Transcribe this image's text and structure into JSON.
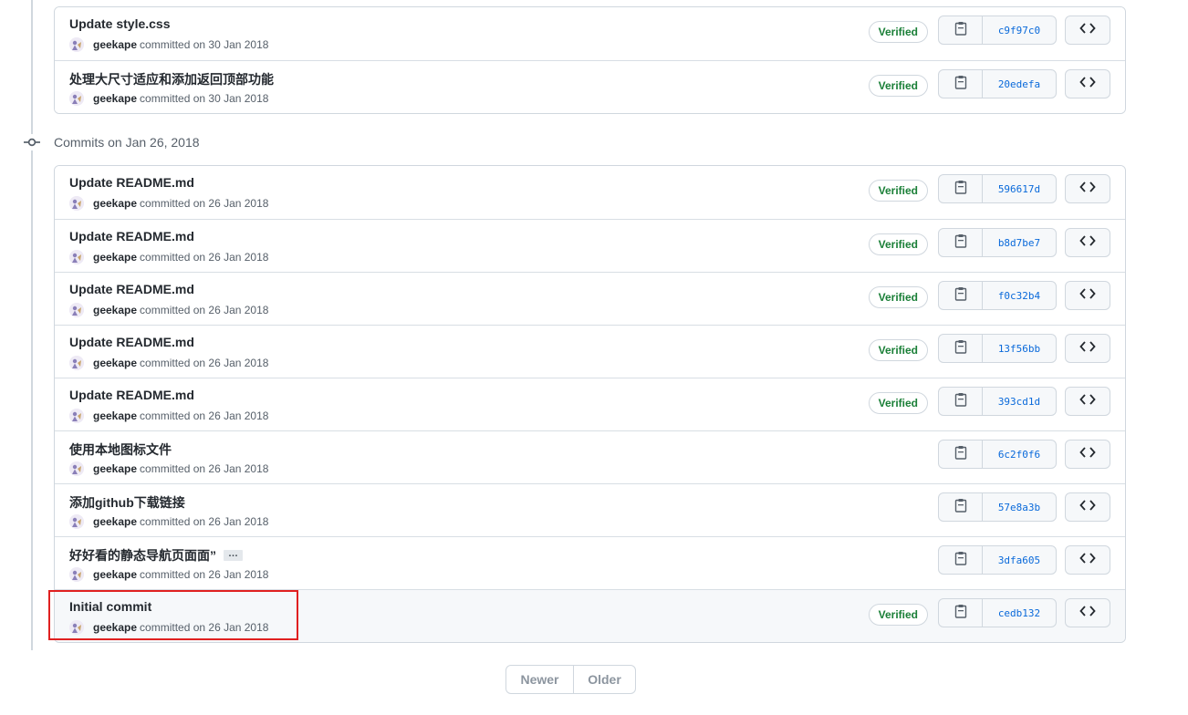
{
  "groups": [
    {
      "header": "",
      "commits": [
        {
          "title": "Update style.css",
          "author": "geekape",
          "date_text": "committed on 30 Jan 2018",
          "verified": "Verified",
          "sha": "c9f97c0"
        },
        {
          "title": "处理大尺寸适应和添加返回顶部功能",
          "author": "geekape",
          "date_text": "committed on 30 Jan 2018",
          "verified": "Verified",
          "sha": "20edefa"
        }
      ]
    },
    {
      "header": "Commits on Jan 26, 2018",
      "commits": [
        {
          "title": "Update README.md",
          "author": "geekape",
          "date_text": "committed on 26 Jan 2018",
          "verified": "Verified",
          "sha": "596617d"
        },
        {
          "title": "Update README.md",
          "author": "geekape",
          "date_text": "committed on 26 Jan 2018",
          "verified": "Verified",
          "sha": "b8d7be7"
        },
        {
          "title": "Update README.md",
          "author": "geekape",
          "date_text": "committed on 26 Jan 2018",
          "verified": "Verified",
          "sha": "f0c32b4"
        },
        {
          "title": "Update README.md",
          "author": "geekape",
          "date_text": "committed on 26 Jan 2018",
          "verified": "Verified",
          "sha": "13f56bb"
        },
        {
          "title": "Update README.md",
          "author": "geekape",
          "date_text": "committed on 26 Jan 2018",
          "verified": "Verified",
          "sha": "393cd1d"
        },
        {
          "title": "使用本地图标文件",
          "author": "geekape",
          "date_text": "committed on 26 Jan 2018",
          "verified": "",
          "sha": "6c2f0f6"
        },
        {
          "title": "添加github下载链接",
          "author": "geekape",
          "date_text": "committed on 26 Jan 2018",
          "verified": "",
          "sha": "57e8a3b"
        },
        {
          "title": "好好看的静态导航页面面”",
          "author": "geekape",
          "date_text": "committed on 26 Jan 2018",
          "verified": "",
          "sha": "3dfa605",
          "ellipsis": "…"
        },
        {
          "title": "Initial commit",
          "author": "geekape",
          "date_text": "committed on 26 Jan 2018",
          "verified": "Verified",
          "sha": "cedb132"
        }
      ]
    }
  ],
  "pagination": {
    "newer": "Newer",
    "older": "Older"
  },
  "icons": {
    "copy": "clipboard-icon",
    "browse": "code-icon",
    "commit_node": "git-commit-icon"
  },
  "colors": {
    "verified": "#1a7f37",
    "sha": "#0969da",
    "highlight": "#e02020"
  }
}
